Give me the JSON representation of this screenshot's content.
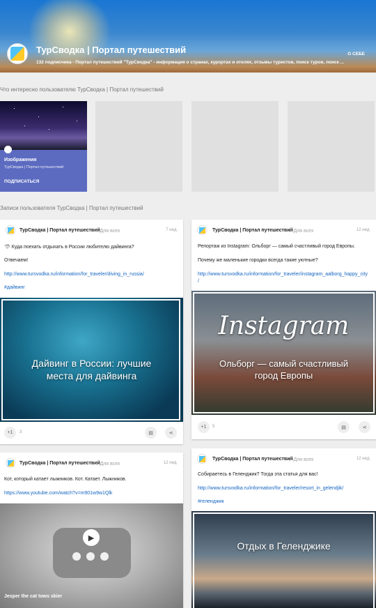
{
  "header": {
    "title": "ТурСводка | Портал путешествий",
    "subtitle": "132 подписчика - Портал путешествий \"ТурСводка\" - информация о странах, курортах и отелях, отзывы туристов, поиск туров, поиск ...",
    "about": "О СЕБЕ"
  },
  "interest_label": "Что интересно пользователю ТурСводка | Портал путешествий",
  "collection": {
    "title": "Изображения",
    "owner": "ТурСводка | Портал путешествий",
    "action": "ПОДПИСАТЬСЯ"
  },
  "posts_label": "Записи пользователя ТурСводка | Портал путешествий",
  "posts": [
    {
      "author": "ТурСводка | Портал путешествий",
      "visibility": "Для всех",
      "time": "7 нед.",
      "line1": "Куда поехать отдыхать в России любителю дайвинга?",
      "line2": "Отвечаем!",
      "link": "http://www.tursvodka.ru/information/for_traveler/diving_in_russia/",
      "tag": "#дайвинг",
      "image_text": "Дайвинг в России: лучшие места для дайвинга",
      "plus": "+1",
      "count": "3"
    },
    {
      "author": "ТурСводка | Портал путешествий",
      "visibility": "Для всех",
      "time": "12 нед.",
      "line1": "Репортаж из Instagram: Ольборг — самый счастливый город Европы.",
      "line2": "Почему же маленькие городки всегда такие уютные?",
      "link": "http://www.tursvodka.ru/information/for_traveler/instagram_aalborg_happy_city",
      "link2": "/",
      "image_brand": "Instagram",
      "image_text": "Ольборг — самый счастливый город Европы",
      "plus": "+1",
      "count": "5"
    },
    {
      "author": "ТурСводка | Портал путешествий",
      "visibility": "Для всех",
      "time": "12 нед.",
      "line1": "Кот, который катает лыжников. Кот. Катает. Лыжников.",
      "link": "https://www.youtube.com/watch?v=m901w9w1Qlk",
      "video_title": "Jesper the cat tows skier"
    },
    {
      "author": "ТурСводка | Портал путешествий",
      "visibility": "Для всех",
      "time": "12 нед.",
      "line1": "Собираетесь в Геленджик? Тогда эта статья для вас!",
      "link": "http://www.tursvodka.ru/information/for_traveler/resort_in_gelendjik/",
      "tag": "#геленджик",
      "image_text": "Отдых в Геленджике"
    }
  ]
}
